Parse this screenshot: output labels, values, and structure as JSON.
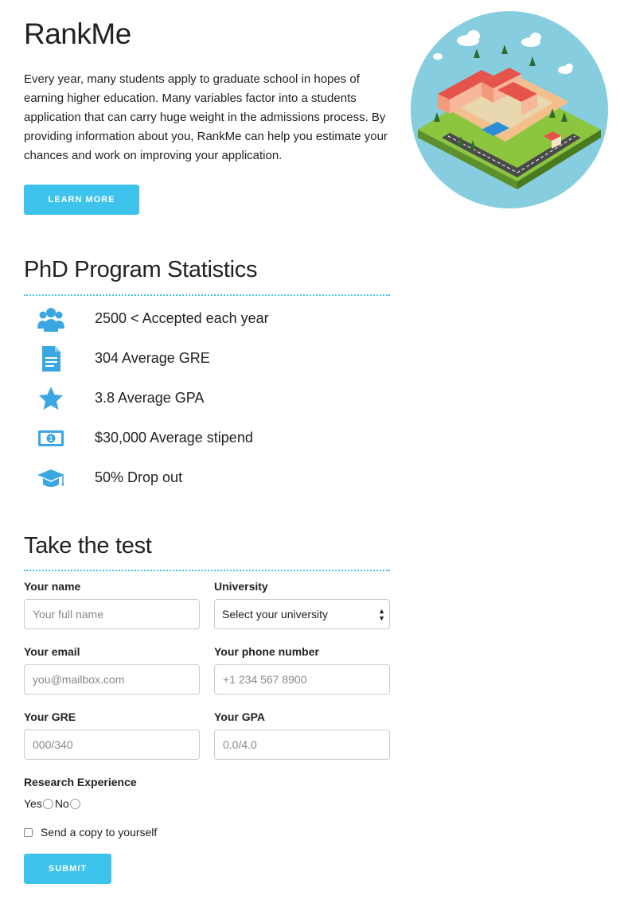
{
  "hero": {
    "title": "RankMe",
    "description": "Every year, many students apply to graduate school in hopes of earning higher education. Many variables factor into a students application that can carry huge weight in the admissions process. By providing information about you, RankMe can help you estimate your chances and work on improving your application.",
    "learn_more_label": "LEARN MORE"
  },
  "stats": {
    "title": "PhD Program Statistics",
    "items": [
      {
        "icon": "users-icon",
        "text": "2500 < Accepted each year"
      },
      {
        "icon": "document-icon",
        "text": "304 Average GRE"
      },
      {
        "icon": "star-icon",
        "text": "3.8 Average GPA"
      },
      {
        "icon": "money-icon",
        "text": "$30,000 Average stipend"
      },
      {
        "icon": "graduation-cap-icon",
        "text": "50% Drop out"
      }
    ]
  },
  "form": {
    "title": "Take the test",
    "name_label": "Your name",
    "name_placeholder": "Your full name",
    "university_label": "University",
    "university_selected": "Select your university",
    "email_label": "Your email",
    "email_placeholder": "you@mailbox.com",
    "phone_label": "Your phone number",
    "phone_placeholder": "+1 234 567 8900",
    "gre_label": "Your GRE",
    "gre_placeholder": "000/340",
    "gpa_label": "Your GPA",
    "gpa_placeholder": "0.0/4.0",
    "research_label": "Research Experience",
    "yes_label": "Yes",
    "no_label": "No",
    "copy_label": "Send a copy to yourself",
    "submit_label": "SUBMIT"
  },
  "colors": {
    "accent": "#3ec3ec",
    "icon_blue": "#3aa6e2"
  }
}
